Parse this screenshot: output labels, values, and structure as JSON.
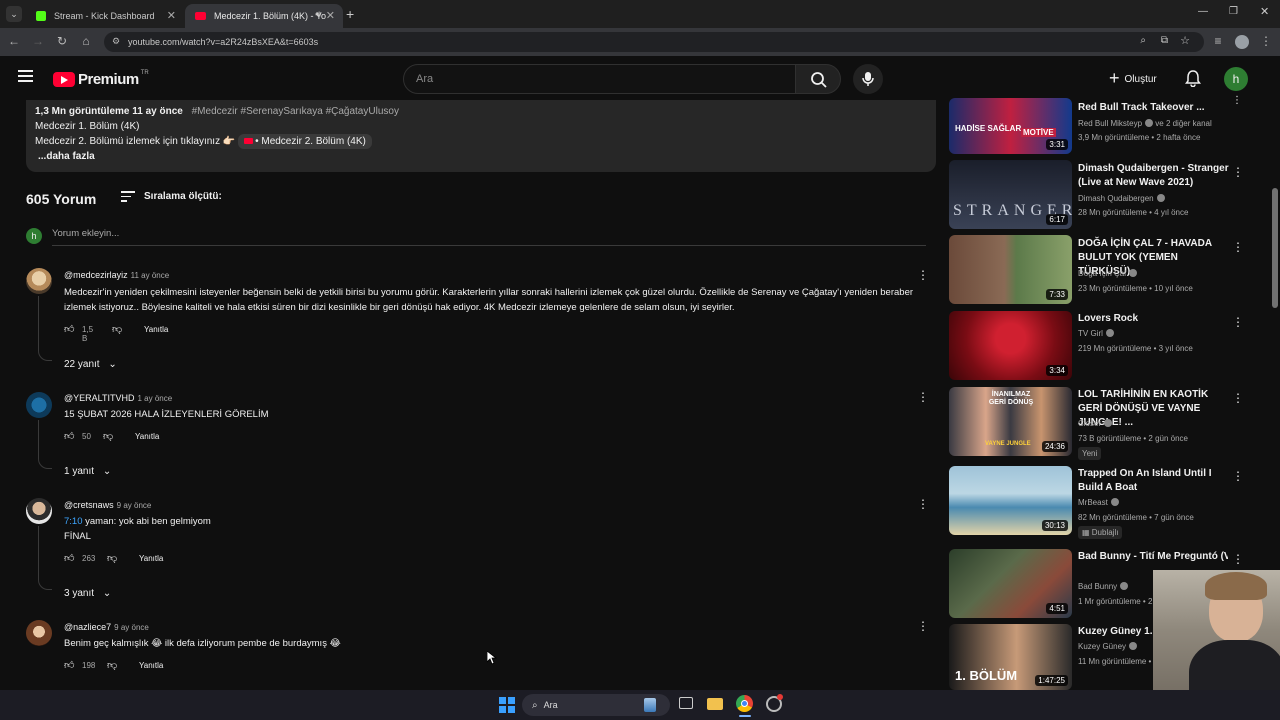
{
  "browser": {
    "tabs": [
      {
        "title": "Stream - Kick Dashboard"
      },
      {
        "title": "Medcezir 1. Bölüm (4K) - Yo"
      }
    ],
    "url": "youtube.com/watch?v=a2R24zBsXEA&t=6603s"
  },
  "yt": {
    "logo_text": "Premium",
    "country": "TR",
    "search_placeholder": "Ara",
    "create_label": "Oluştur",
    "avatar_letter": "h"
  },
  "description": {
    "stats": "1,3 Mn görüntüleme  11 ay önce",
    "hashtags": "#Medcezir #SerenaySarıkaya #ÇağatayUlusoy",
    "line2": "Medcezir 1. Bölüm (4K)",
    "line3": "Medcezir 2. Bölümü izlemek için tıklayınız 👉🏻",
    "line3_link": "• Medcezir 2. Bölüm (4K)",
    "more": "...daha fazla"
  },
  "comments_header": {
    "count": "605 Yorum",
    "sort": "Sıralama ölçütü:",
    "add_placeholder": "Yorum ekleyin...",
    "user_letter": "h"
  },
  "comments": [
    {
      "author": "@medcezirlayiz",
      "time": "11 ay önce",
      "text": "Medcezir'in yeniden çekilmesini isteyenler beğensin belki de yetkili birisi bu yorumu görür. Karakterlerin yıllar sonraki hallerini izlemek çok güzel olurdu. Özellikle de Serenay ve Çağatay'ı yeniden beraber izlemek istiyoruz.. Böylesine kaliteli ve hala etkisi süren bir dizi kesinlikle bir geri dönüşü hak ediyor. 4K Medcezir izlemeye gelenlere de selam olsun, iyi seyirler.",
      "likes": "1,5 B",
      "reply": "Yanıtla",
      "replies": "22 yanıt"
    },
    {
      "author": "@YERALTITVHD",
      "time": "1 ay önce",
      "text": "15 ŞUBAT 2026 HALA İZLEYENLERİ GÖRELİM",
      "likes": "50",
      "reply": "Yanıtla",
      "replies": "1 yanıt"
    },
    {
      "author": "@cretsnaws",
      "time": "9 ay önce",
      "timestamp_link": "7:10",
      "text": " yaman: yok abi ben gelmiyom",
      "text2": "FİNAL",
      "likes": "263",
      "reply": "Yanıtla",
      "replies": "3 yanıt"
    },
    {
      "author": "@nazliece7",
      "time": "9 ay önce",
      "text": "Benim geç kalmışlık 😂 ilk defa izliyorum pembe de burdaymış 😂",
      "likes": "198",
      "reply": "Yanıtla"
    }
  ],
  "sidebar": [
    {
      "title": "Red Bull Track Takeover ...",
      "channel": "Red Bull Miksteyp",
      "channel_extra": "ve 2 diğer kanal",
      "meta": "3,9 Mn görüntüleme • 2 hafta önce",
      "duration": "3:31"
    },
    {
      "title": "Dimash Qudaibergen - Stranger (Live at New Wave 2021)",
      "channel": "Dimash Qudaibergen",
      "meta": "28 Mn görüntüleme • 4 yıl önce",
      "duration": "6:17"
    },
    {
      "title": "DOĞA İÇİN ÇAL 7 - HAVADA BULUT YOK (YEMEN TÜRKÜSÜ)",
      "channel": "Doğa İçin Çal",
      "meta": "23 Mn görüntüleme • 10 yıl önce",
      "duration": "7:33"
    },
    {
      "title": "Lovers Rock",
      "channel": "TV Girl",
      "meta": "219 Mn görüntüleme • 3 yıl önce",
      "duration": "3:34"
    },
    {
      "title": "LOL TARİHİNİN EN KAOTİK GERİ DÖNÜŞÜ VE VAYNE JUNGLE! ...",
      "channel": "Closer",
      "meta": "73 B görüntüleme • 2 gün önce",
      "badge": "Yeni",
      "duration": "24:36"
    },
    {
      "title": "Trapped On An Island Until I Build A Boat",
      "channel": "MrBeast",
      "meta": "82 Mn görüntüleme • 7 gün önce",
      "badge": "Dublajlı",
      "duration": "30:13"
    },
    {
      "title": "Bad Bunny - Tití Me Preguntó (Video Oficial) | Un Verano Sin Ti",
      "channel": "Bad Bunny",
      "meta": "1 Mr görüntüleme • 2 yıl önce",
      "duration": "4:51"
    },
    {
      "title": "Kuzey Güney 1. Bölüm",
      "channel": "Kuzey Güney",
      "meta": "11 Mn görüntüleme • 12 yıl önce",
      "duration": "1:47:25"
    }
  ],
  "thumb_text": {
    "t1": "HADİSE SAĞLAR",
    "t1b": "MOTİVE",
    "t2": "STRANGER",
    "t5": "İNANILMAZ GERİ DÖNÜŞ",
    "t5b": "VAYNE JUNGLE",
    "t8": "1. BÖLÜM"
  },
  "taskbar": {
    "search": "Ara"
  }
}
